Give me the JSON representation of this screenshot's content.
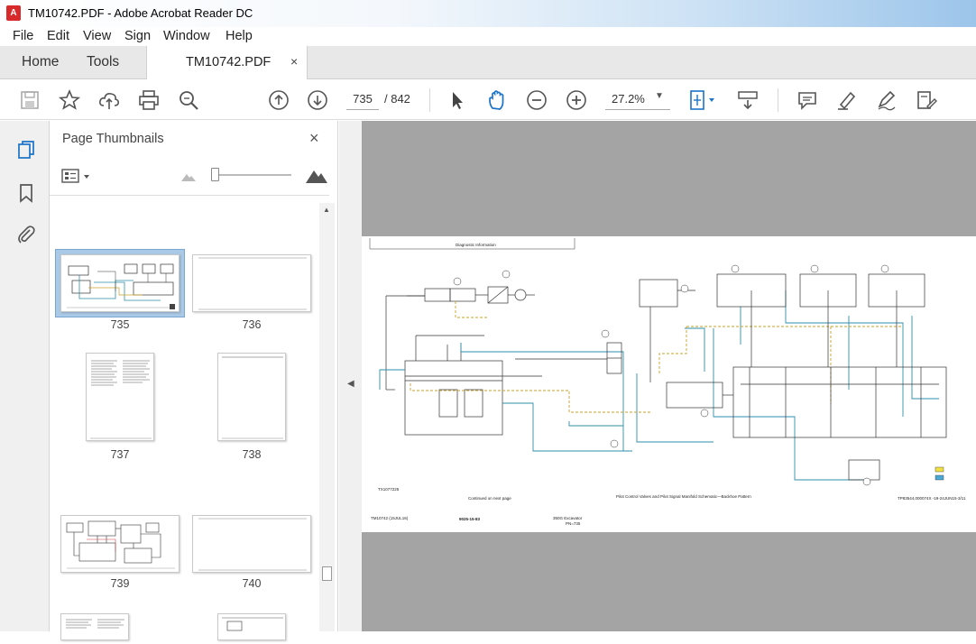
{
  "window": {
    "title": "TM10742.PDF - Adobe Acrobat Reader DC",
    "icon": "pdf-app-icon",
    "icon_text": "A"
  },
  "menu": [
    "File",
    "Edit",
    "View",
    "Sign",
    "Window",
    "Help"
  ],
  "tabs": {
    "home": "Home",
    "tools": "Tools",
    "document": "TM10742.PDF",
    "close": "×"
  },
  "toolbar": {
    "page_current": "735",
    "page_total": "/ 842",
    "zoom": "27.2%",
    "icons": [
      "save-icon",
      "bookmark-star-icon",
      "cloud-upload-icon",
      "print-icon",
      "find-zoom-icon",
      "page-up-icon",
      "page-down-icon",
      "select-arrow-icon",
      "hand-icon",
      "zoom-out-icon",
      "zoom-in-icon",
      "fit-page-icon",
      "scroll-mode-icon",
      "comment-icon",
      "highlight-icon",
      "sign-icon",
      "edit-pdf-icon"
    ]
  },
  "left_rail": [
    "page-thumbnails-icon",
    "bookmarks-icon",
    "attachments-icon"
  ],
  "panel": {
    "title": "Page Thumbnails",
    "close": "×",
    "thumbnails": [
      {
        "label": "735",
        "selected": true
      },
      {
        "label": "736",
        "selected": false
      },
      {
        "label": "737",
        "selected": false
      },
      {
        "label": "738",
        "selected": false
      },
      {
        "label": "739",
        "selected": false
      },
      {
        "label": "740",
        "selected": false
      }
    ]
  },
  "document": {
    "header": "Diagnostic Information",
    "sheet_id": "TX1077225",
    "continued": "Continued on next page",
    "caption": "Pilot Control Valves and Pilot Signal Manifold Schematic—Backhoe Pattern",
    "ref": "TP83544,000074X -19-24JUN15-3/11",
    "footer_left": "TM10742 (15JUL16)",
    "footer_center": "9025-15-83",
    "footer_right_1": "TX1077225",
    "footer_right_2": "350G Excavator",
    "footer_right_3": "PN=735"
  },
  "colors": {
    "accent": "#1a73c8",
    "schematic_teal": "#2f8fa8",
    "schematic_gold": "#c9a227",
    "viewer_bg": "#a4a4a4"
  }
}
